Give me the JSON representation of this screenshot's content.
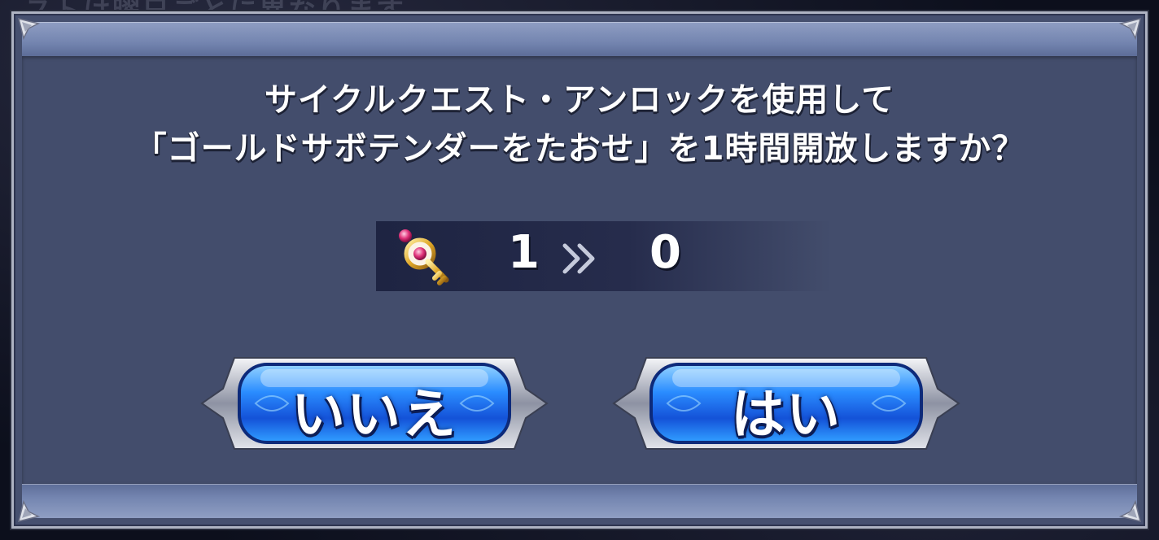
{
  "background": {
    "faded_text": "ストは曜日ごとに異なります"
  },
  "dialog": {
    "message_line1": "サイクルクエスト・アンロックを使用して",
    "message_line2": "「ゴールドサボテンダーをたおせ」を1時間開放しますか？",
    "item": {
      "icon": "key-icon",
      "count_before": "1",
      "count_after": "0",
      "arrow": "»"
    },
    "buttons": {
      "no_label": "いいえ",
      "yes_label": "はい"
    }
  },
  "colors": {
    "panel": "#434d6c",
    "band": "#7485b0",
    "button_blue": "#1f6ff0",
    "text": "#ffffff"
  }
}
